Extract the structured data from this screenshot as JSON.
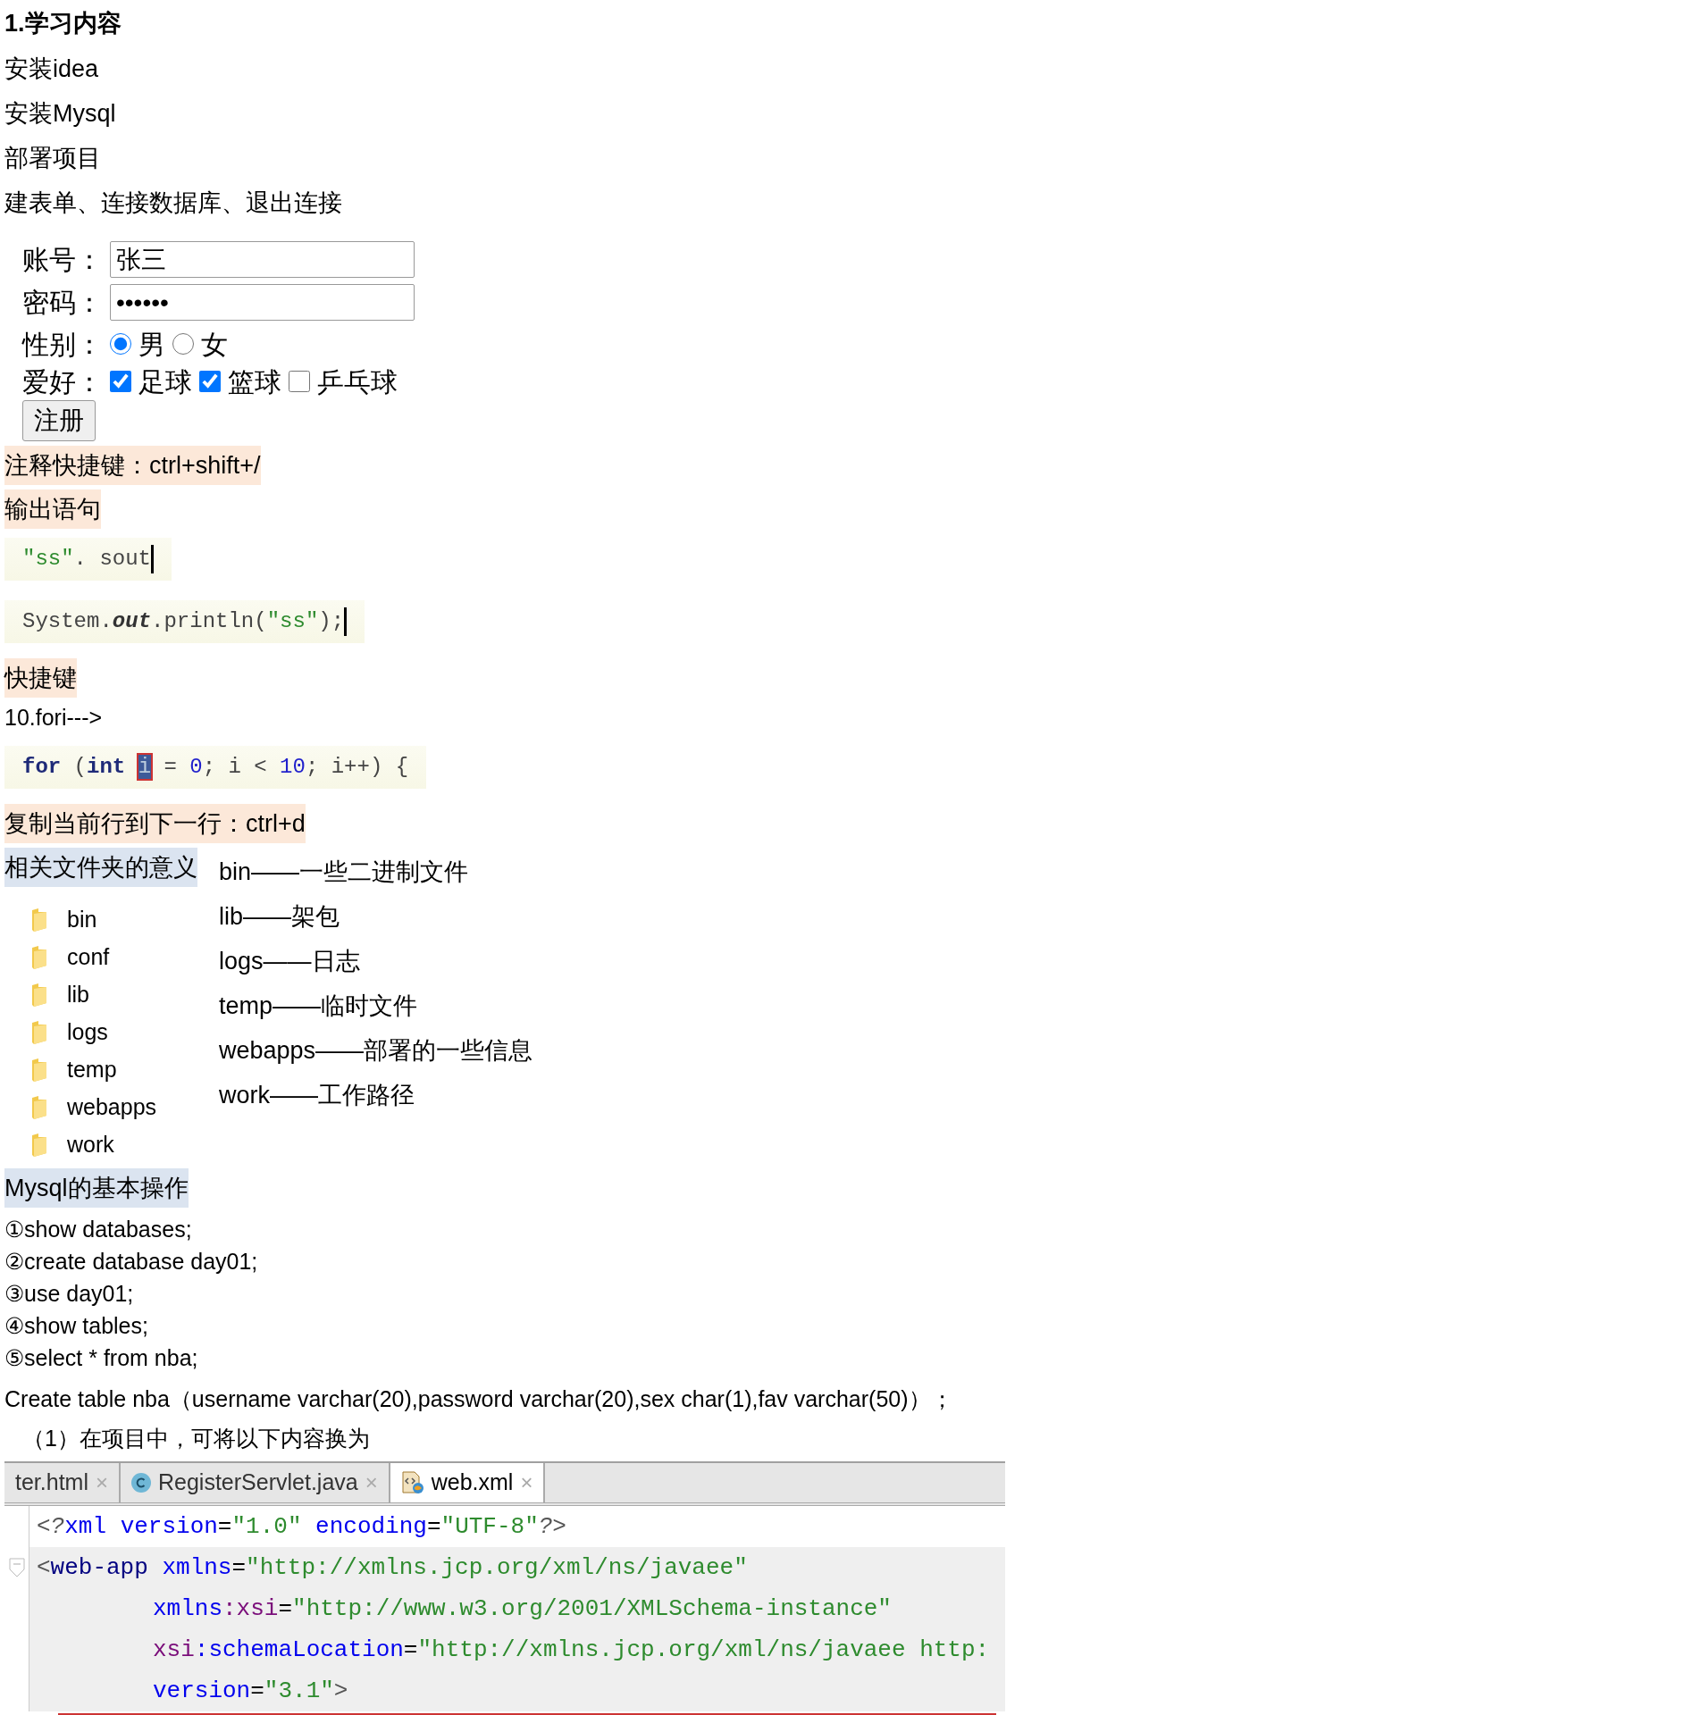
{
  "heading": "1.学习内容",
  "steps": [
    "安装idea",
    "安装Mysql",
    "部署项目",
    "建表单、连接数据库、退出连接"
  ],
  "form": {
    "fields": [
      {
        "label": "账号：",
        "value": "张三"
      },
      {
        "label": "密码：",
        "value": "••••••"
      }
    ],
    "gender": {
      "label": "性别：",
      "options": [
        {
          "label": "男",
          "selected": true
        },
        {
          "label": "女",
          "selected": false
        }
      ]
    },
    "hobbies": {
      "label": "爱好：",
      "options": [
        {
          "label": "足球",
          "checked": true
        },
        {
          "label": "篮球",
          "checked": true
        },
        {
          "label": "乒乓球",
          "checked": false
        }
      ]
    },
    "submit": "注册"
  },
  "blocks": [
    {
      "kind": "note",
      "text": "注释快捷键：ctrl+shift+/",
      "color": "#fce8d9"
    },
    {
      "kind": "note",
      "text": "输出语句",
      "color": "#fce8d9"
    },
    {
      "kind": "code",
      "cursor": true,
      "tokens": [
        {
          "text": "″ss″",
          "kind": "string"
        },
        {
          "text": ". sout",
          "kind": "plain"
        }
      ]
    },
    {
      "kind": "code",
      "cursor": true,
      "tokens": [
        {
          "text": "System.",
          "kind": "plain"
        },
        {
          "text": "out",
          "kind": "italic"
        },
        {
          "text": ".println(",
          "kind": "plain"
        },
        {
          "text": "″ss″",
          "kind": "string"
        },
        {
          "text": ");",
          "kind": "plain"
        }
      ]
    },
    {
      "kind": "note",
      "text": "快捷键",
      "color": "#fce8d9"
    },
    {
      "kind": "text",
      "text": "10.fori--->"
    },
    {
      "kind": "code",
      "cursor": false,
      "tokens": [
        {
          "text": "for",
          "kind": "keyword"
        },
        {
          "text": " (",
          "kind": "plain"
        },
        {
          "text": "int ",
          "kind": "keyword"
        },
        {
          "text": "i",
          "kind": "selected"
        },
        {
          "text": " = ",
          "kind": "plain"
        },
        {
          "text": "0",
          "kind": "number"
        },
        {
          "text": "; i < ",
          "kind": "plain"
        },
        {
          "text": "10",
          "kind": "number"
        },
        {
          "text": "; i++) {",
          "kind": "plain"
        }
      ]
    },
    {
      "kind": "note",
      "text": "复制当前行到下一行：ctrl+d",
      "color": "#fce8d9"
    },
    {
      "kind": "folders",
      "title": "相关文件夹的意义",
      "color": "#dbe4f0",
      "folders": [
        "bin",
        "conf",
        "lib",
        "logs",
        "temp",
        "webapps",
        "work"
      ],
      "meanings": [
        "bin——一些二进制文件",
        "lib——架包",
        "logs——日志",
        "temp——临时文件",
        "webapps——部署的一些信息",
        "work——工作路径"
      ]
    },
    {
      "kind": "note",
      "text": "Mysql的基本操作",
      "color": "#dbe4f0"
    },
    {
      "kind": "list",
      "items": [
        "①show databases;",
        "②create database day01;",
        "③use day01;",
        "④show tables;",
        "⑤select * from nba;"
      ]
    },
    {
      "kind": "text",
      "text": "Create table nba（username varchar(20),password varchar(20),sex char(1),fav varchar(50)）；"
    },
    {
      "kind": "text",
      "text": "（1）在项目中，可将以下内容换为"
    },
    {
      "kind": "editor",
      "tabs": [
        {
          "label": "ter.html",
          "kind": "plain",
          "selected": false,
          "close": "×"
        },
        {
          "label": "RegisterServlet.java",
          "kind": "java",
          "selected": false,
          "close": "×"
        },
        {
          "label": "web.xml",
          "kind": "xml",
          "selected": true,
          "close": "×"
        }
      ],
      "lines": [
        {
          "indent": false,
          "highlighted": false,
          "fold": false,
          "tokens": [
            {
              "text": "<?",
              "kind": "punct"
            },
            {
              "text": "xml",
              "kind": "attr"
            },
            {
              "text": " version",
              "kind": "attr"
            },
            {
              "text": "=",
              "kind": "plain"
            },
            {
              "text": "″1.0″",
              "kind": "string"
            },
            {
              "text": " encoding",
              "kind": "attr"
            },
            {
              "text": "=",
              "kind": "plain"
            },
            {
              "text": "″UTF-8″",
              "kind": "string"
            },
            {
              "text": "?>",
              "kind": "punct"
            }
          ]
        },
        {
          "indent": false,
          "highlighted": true,
          "fold": true,
          "tokens": [
            {
              "text": "<",
              "kind": "punct"
            },
            {
              "text": "web-app",
              "kind": "tag"
            },
            {
              "text": " xmlns",
              "kind": "attr"
            },
            {
              "text": "=",
              "kind": "plain"
            },
            {
              "text": "″http://xmlns.jcp.org/xml/ns/javaee″",
              "kind": "string"
            }
          ]
        },
        {
          "indent": true,
          "highlighted": true,
          "fold": false,
          "tokens": [
            {
              "text": "xmlns",
              "kind": "attr"
            },
            {
              "text": ":xsi",
              "kind": "ns"
            },
            {
              "text": "=",
              "kind": "plain"
            },
            {
              "text": "″http://www.w3.org/2001/XMLSchema-instance″",
              "kind": "string"
            }
          ]
        },
        {
          "indent": true,
          "highlighted": true,
          "fold": false,
          "tokens": [
            {
              "text": "xsi",
              "kind": "ns"
            },
            {
              "text": ":schemaLocation",
              "kind": "attr"
            },
            {
              "text": "=",
              "kind": "plain"
            },
            {
              "text": "″http://xmlns.jcp.org/xml/ns/javaee http:",
              "kind": "string"
            }
          ]
        },
        {
          "indent": true,
          "highlighted": true,
          "fold": false,
          "tokens": [
            {
              "text": "version",
              "kind": "attr"
            },
            {
              "text": "=",
              "kind": "plain"
            },
            {
              "text": "″3.1″",
              "kind": "string"
            },
            {
              "text": ">",
              "kind": "punct"
            }
          ]
        }
      ]
    }
  ]
}
